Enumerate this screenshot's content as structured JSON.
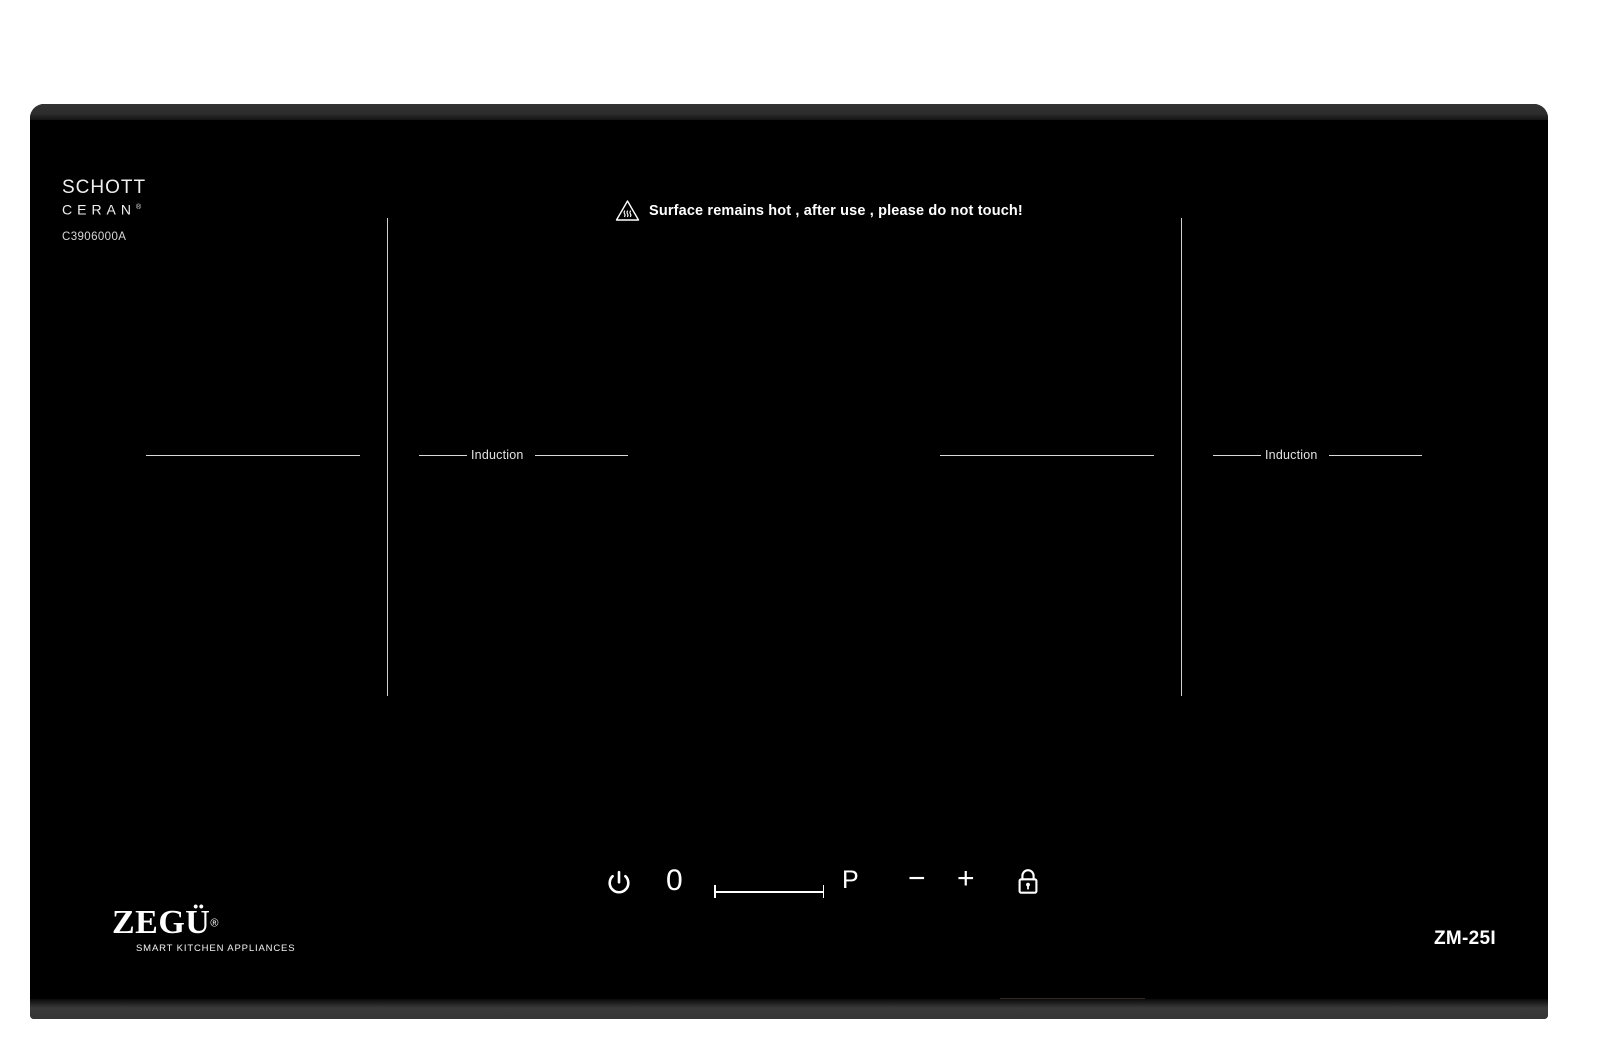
{
  "appliance": {
    "brand": "ZEGÜ",
    "brand_registered": "®",
    "tagline": "SMART KITCHEN APPLIANCES",
    "model": "ZM-25I",
    "surface_brand_line1": "SCHOTT",
    "surface_brand_line2": "CERAN",
    "surface_brand_registered": "®",
    "surface_code": "C3906000A"
  },
  "warning": {
    "icon": "hot-surface-icon",
    "text": "Surface remains hot , after use , please do not touch!"
  },
  "zones": [
    {
      "id": "left-outer",
      "label": "",
      "type": "zone-mark"
    },
    {
      "id": "left-inner",
      "label": "Induction",
      "type": "induction-zone"
    },
    {
      "id": "right-outer",
      "label": "",
      "type": "zone-mark"
    },
    {
      "id": "right-inner",
      "label": "Induction",
      "type": "induction-zone"
    }
  ],
  "controls": {
    "power_icon": "power-icon",
    "display_value": "0",
    "slider_icon": "slider-track",
    "boost_label": "P",
    "decrease_label": "−",
    "increase_label": "+",
    "lock_icon": "lock-icon"
  },
  "colors": {
    "glass": "#000000",
    "bezel": "#333333",
    "marking": "#d9d9d9",
    "text": "#ffffff",
    "background": "#ffffff"
  }
}
